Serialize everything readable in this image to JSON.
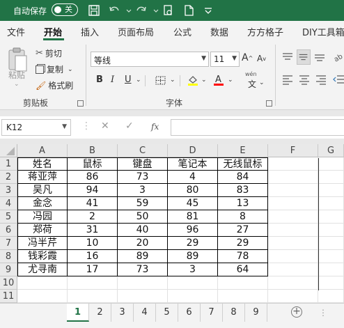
{
  "titlebar": {
    "autosave_label": "自动保存",
    "toggle_state": "关"
  },
  "tabs": [
    "文件",
    "开始",
    "插入",
    "页面布局",
    "公式",
    "数据",
    "方方格子",
    "DIY工具箱"
  ],
  "ribbon": {
    "paste": "粘贴",
    "cut": "剪切",
    "copy": "复制",
    "format_painter": "格式刷",
    "clipboard_group": "剪贴板",
    "font_name": "等线",
    "font_size": "11",
    "bold": "B",
    "italic": "I",
    "underline": "U",
    "wen": "wén",
    "font_group": "字体"
  },
  "formula_bar": {
    "name_box": "K12",
    "fx": "fx",
    "formula": ""
  },
  "columns": [
    "A",
    "B",
    "C",
    "D",
    "E",
    "F",
    "G"
  ],
  "rows": [
    "1",
    "2",
    "3",
    "4",
    "5",
    "6",
    "7",
    "8",
    "9",
    "10",
    "11"
  ],
  "table": {
    "headers": [
      "姓名",
      "鼠标",
      "键盘",
      "笔记本",
      "无线鼠标"
    ],
    "rows": [
      [
        "蒋亚萍",
        "86",
        "73",
        "4",
        "84"
      ],
      [
        "吴凡",
        "94",
        "3",
        "80",
        "83"
      ],
      [
        "金念",
        "41",
        "59",
        "45",
        "13"
      ],
      [
        "冯园",
        "2",
        "50",
        "81",
        "8"
      ],
      [
        "郑荷",
        "31",
        "40",
        "96",
        "27"
      ],
      [
        "冯半芹",
        "10",
        "20",
        "29",
        "29"
      ],
      [
        "钱彩霞",
        "16",
        "89",
        "89",
        "78"
      ],
      [
        "尤寻南",
        "17",
        "73",
        "3",
        "64"
      ]
    ]
  },
  "sheets": [
    "1",
    "2",
    "3",
    "4",
    "5",
    "6",
    "7",
    "8",
    "9"
  ],
  "active_sheet": "1",
  "colors": {
    "accent": "#217346",
    "table_border": "#000000"
  }
}
